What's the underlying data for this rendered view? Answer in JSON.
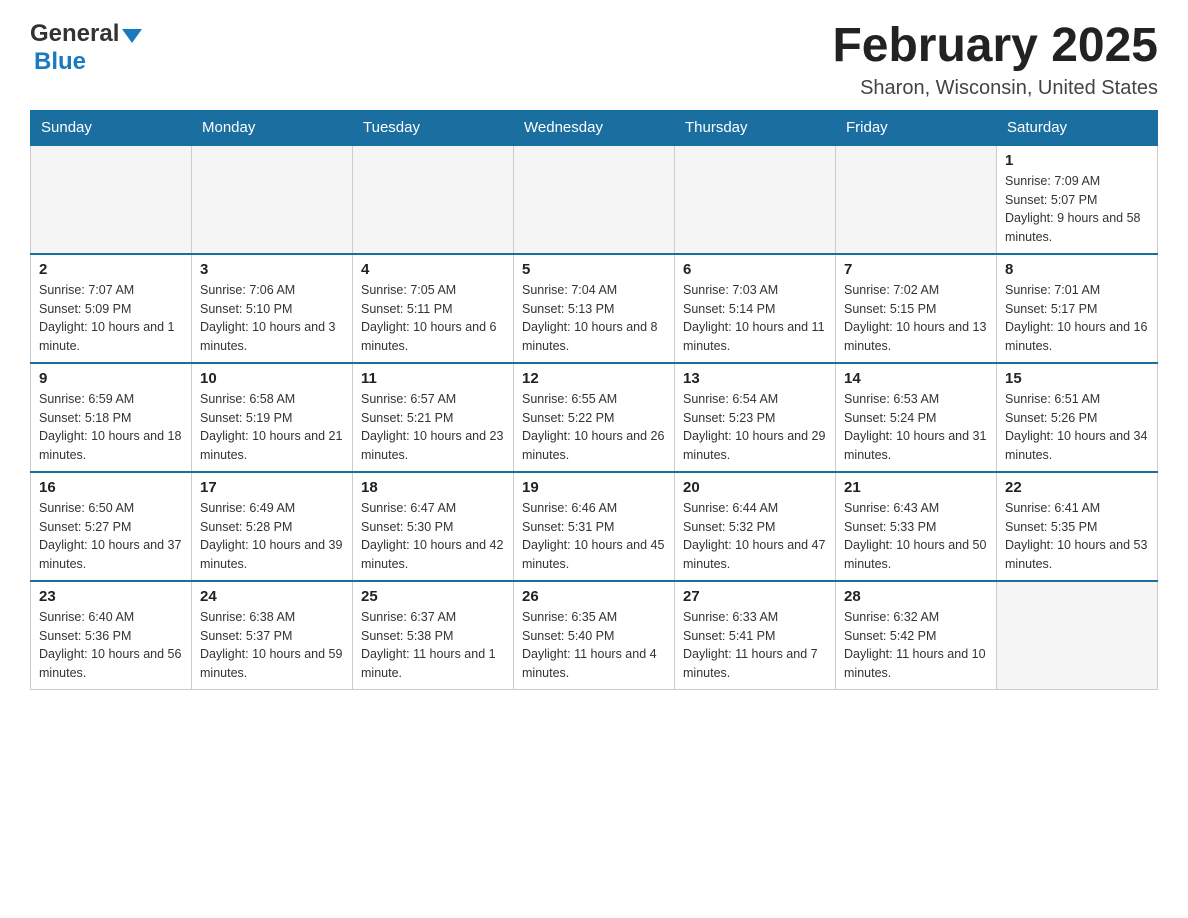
{
  "header": {
    "logo_general": "General",
    "logo_blue": "Blue",
    "title": "February 2025",
    "location": "Sharon, Wisconsin, United States"
  },
  "calendar": {
    "days_of_week": [
      "Sunday",
      "Monday",
      "Tuesday",
      "Wednesday",
      "Thursday",
      "Friday",
      "Saturday"
    ],
    "weeks": [
      [
        {
          "day": "",
          "info": ""
        },
        {
          "day": "",
          "info": ""
        },
        {
          "day": "",
          "info": ""
        },
        {
          "day": "",
          "info": ""
        },
        {
          "day": "",
          "info": ""
        },
        {
          "day": "",
          "info": ""
        },
        {
          "day": "1",
          "info": "Sunrise: 7:09 AM\nSunset: 5:07 PM\nDaylight: 9 hours and 58 minutes."
        }
      ],
      [
        {
          "day": "2",
          "info": "Sunrise: 7:07 AM\nSunset: 5:09 PM\nDaylight: 10 hours and 1 minute."
        },
        {
          "day": "3",
          "info": "Sunrise: 7:06 AM\nSunset: 5:10 PM\nDaylight: 10 hours and 3 minutes."
        },
        {
          "day": "4",
          "info": "Sunrise: 7:05 AM\nSunset: 5:11 PM\nDaylight: 10 hours and 6 minutes."
        },
        {
          "day": "5",
          "info": "Sunrise: 7:04 AM\nSunset: 5:13 PM\nDaylight: 10 hours and 8 minutes."
        },
        {
          "day": "6",
          "info": "Sunrise: 7:03 AM\nSunset: 5:14 PM\nDaylight: 10 hours and 11 minutes."
        },
        {
          "day": "7",
          "info": "Sunrise: 7:02 AM\nSunset: 5:15 PM\nDaylight: 10 hours and 13 minutes."
        },
        {
          "day": "8",
          "info": "Sunrise: 7:01 AM\nSunset: 5:17 PM\nDaylight: 10 hours and 16 minutes."
        }
      ],
      [
        {
          "day": "9",
          "info": "Sunrise: 6:59 AM\nSunset: 5:18 PM\nDaylight: 10 hours and 18 minutes."
        },
        {
          "day": "10",
          "info": "Sunrise: 6:58 AM\nSunset: 5:19 PM\nDaylight: 10 hours and 21 minutes."
        },
        {
          "day": "11",
          "info": "Sunrise: 6:57 AM\nSunset: 5:21 PM\nDaylight: 10 hours and 23 minutes."
        },
        {
          "day": "12",
          "info": "Sunrise: 6:55 AM\nSunset: 5:22 PM\nDaylight: 10 hours and 26 minutes."
        },
        {
          "day": "13",
          "info": "Sunrise: 6:54 AM\nSunset: 5:23 PM\nDaylight: 10 hours and 29 minutes."
        },
        {
          "day": "14",
          "info": "Sunrise: 6:53 AM\nSunset: 5:24 PM\nDaylight: 10 hours and 31 minutes."
        },
        {
          "day": "15",
          "info": "Sunrise: 6:51 AM\nSunset: 5:26 PM\nDaylight: 10 hours and 34 minutes."
        }
      ],
      [
        {
          "day": "16",
          "info": "Sunrise: 6:50 AM\nSunset: 5:27 PM\nDaylight: 10 hours and 37 minutes."
        },
        {
          "day": "17",
          "info": "Sunrise: 6:49 AM\nSunset: 5:28 PM\nDaylight: 10 hours and 39 minutes."
        },
        {
          "day": "18",
          "info": "Sunrise: 6:47 AM\nSunset: 5:30 PM\nDaylight: 10 hours and 42 minutes."
        },
        {
          "day": "19",
          "info": "Sunrise: 6:46 AM\nSunset: 5:31 PM\nDaylight: 10 hours and 45 minutes."
        },
        {
          "day": "20",
          "info": "Sunrise: 6:44 AM\nSunset: 5:32 PM\nDaylight: 10 hours and 47 minutes."
        },
        {
          "day": "21",
          "info": "Sunrise: 6:43 AM\nSunset: 5:33 PM\nDaylight: 10 hours and 50 minutes."
        },
        {
          "day": "22",
          "info": "Sunrise: 6:41 AM\nSunset: 5:35 PM\nDaylight: 10 hours and 53 minutes."
        }
      ],
      [
        {
          "day": "23",
          "info": "Sunrise: 6:40 AM\nSunset: 5:36 PM\nDaylight: 10 hours and 56 minutes."
        },
        {
          "day": "24",
          "info": "Sunrise: 6:38 AM\nSunset: 5:37 PM\nDaylight: 10 hours and 59 minutes."
        },
        {
          "day": "25",
          "info": "Sunrise: 6:37 AM\nSunset: 5:38 PM\nDaylight: 11 hours and 1 minute."
        },
        {
          "day": "26",
          "info": "Sunrise: 6:35 AM\nSunset: 5:40 PM\nDaylight: 11 hours and 4 minutes."
        },
        {
          "day": "27",
          "info": "Sunrise: 6:33 AM\nSunset: 5:41 PM\nDaylight: 11 hours and 7 minutes."
        },
        {
          "day": "28",
          "info": "Sunrise: 6:32 AM\nSunset: 5:42 PM\nDaylight: 11 hours and 10 minutes."
        },
        {
          "day": "",
          "info": ""
        }
      ]
    ]
  }
}
